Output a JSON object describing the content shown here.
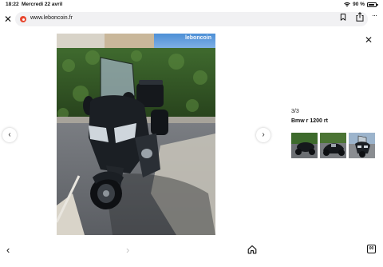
{
  "status": {
    "time": "18:22",
    "date": "Mercredi 22 avril",
    "battery_percent": "90 %",
    "battery_level": 0.9
  },
  "browser": {
    "url": "www.leboncoin.fr",
    "tabs_count": "00"
  },
  "photo": {
    "watermark": "leboncoin"
  },
  "gallery": {
    "counter": "3/3",
    "title": "Bmw r 1200 rt",
    "thumbnail_count": 3
  },
  "nav": {
    "prev_icon": "chevron-left-icon",
    "next_icon": "chevron-right-icon",
    "close_icon": "close-icon"
  },
  "colors": {
    "site_icon": "#e8472f",
    "url_bar_bg": "#f1f1f3"
  }
}
